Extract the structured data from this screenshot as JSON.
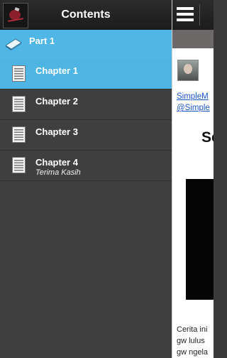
{
  "drawer": {
    "title": "Contents",
    "part": {
      "label": "Part 1"
    },
    "chapters": [
      {
        "label": "Chapter 1",
        "subtitle": "",
        "selected": true
      },
      {
        "label": "Chapter 2",
        "subtitle": "",
        "selected": false
      },
      {
        "label": "Chapter 3",
        "subtitle": "",
        "selected": false
      },
      {
        "label": "Chapter 4",
        "subtitle": "Terima Kasih",
        "selected": false
      }
    ]
  },
  "main": {
    "author_link": "SimpleM",
    "handle_link": "@Simple",
    "heading": "Se",
    "body_lines": [
      "Cerita ini",
      "gw lulus",
      "gw ngela"
    ]
  },
  "colors": {
    "accent": "#50b6e6",
    "drawer_bg": "#3f3f3f",
    "header_bg": "#1c1c1c",
    "link": "#1a55c9"
  },
  "icons": {
    "part": "book-icon",
    "chapter": "document-icon",
    "menu": "hamburger-menu-icon"
  }
}
